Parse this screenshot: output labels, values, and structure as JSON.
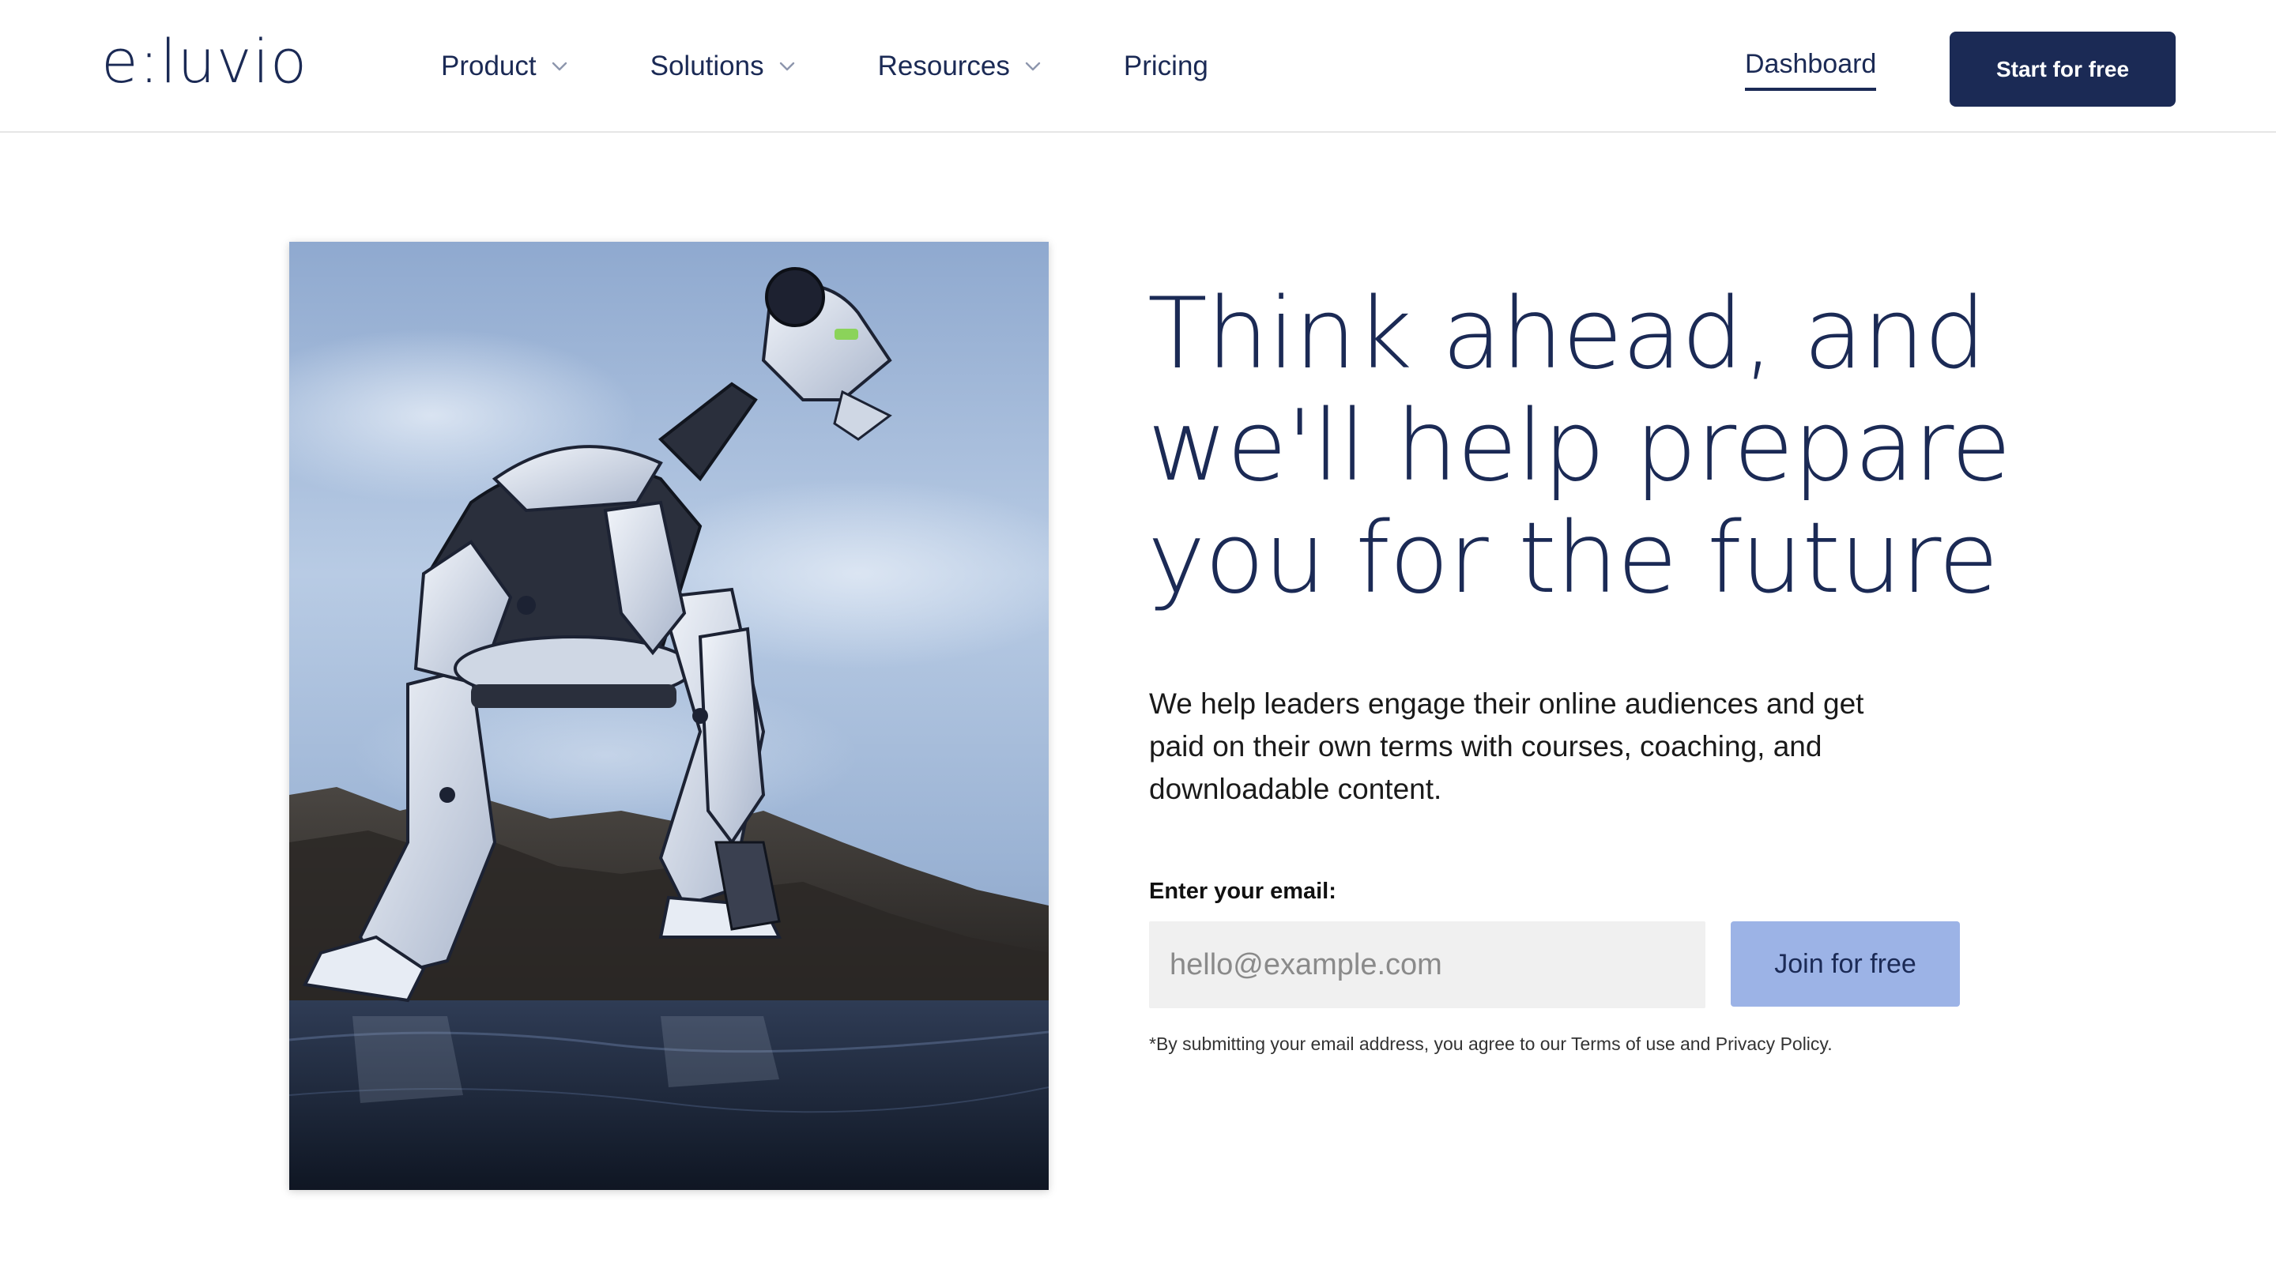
{
  "brand": {
    "logo_text": "e:luvio",
    "primary_color": "#1b2a55",
    "accent_color": "#9cb3e6"
  },
  "nav": {
    "items": [
      {
        "label": "Product",
        "has_dropdown": true
      },
      {
        "label": "Solutions",
        "has_dropdown": true
      },
      {
        "label": "Resources",
        "has_dropdown": true
      },
      {
        "label": "Pricing",
        "has_dropdown": false
      }
    ],
    "dashboard_label": "Dashboard",
    "cta_label": "Start for free"
  },
  "hero": {
    "image_alt": "robot-crouching-on-rocks",
    "headline_lines": [
      "Think ahead, and",
      "we'll help prepare",
      "you for the future"
    ],
    "subtext_lines": [
      "We help leaders engage their online audiences and get",
      "paid on their own terms with courses, coaching, and",
      "downloadable content."
    ],
    "email_label": "Enter your email:",
    "email_placeholder": "hello@example.com",
    "email_value": "",
    "join_label": "Join for free",
    "disclaimer": "*By submitting your email address, you agree to our Terms of use and Privacy Policy."
  }
}
